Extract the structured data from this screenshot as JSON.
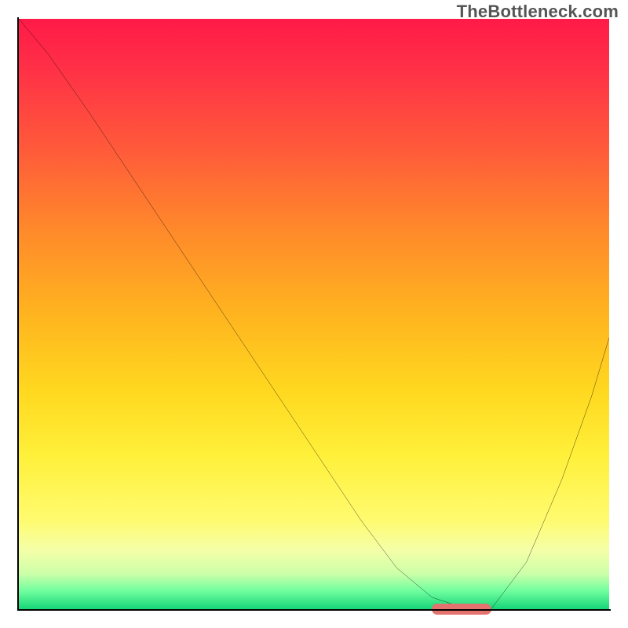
{
  "watermark": "TheBottleneck.com",
  "colors": {
    "gradient_top": "#ff1a47",
    "gradient_mid": "#ffd81f",
    "gradient_bottom": "#16d577",
    "curve": "#000000",
    "frame": "#000000",
    "optimum_marker": "#e4726e"
  },
  "chart_data": {
    "type": "line",
    "title": "",
    "xlabel": "",
    "ylabel": "",
    "xlim": [
      0,
      100
    ],
    "ylim": [
      0,
      100
    ],
    "grid": false,
    "legend": false,
    "annotations": [
      {
        "text": "TheBottleneck.com",
        "position": "top-right"
      }
    ],
    "series": [
      {
        "name": "bottleneck-curve",
        "x": [
          0,
          5,
          12,
          20,
          24,
          30,
          40,
          50,
          58,
          64,
          70,
          76,
          80,
          86,
          92,
          97,
          100
        ],
        "y": [
          100,
          94,
          84,
          72,
          66,
          57,
          42,
          27,
          15,
          7,
          2,
          0,
          0,
          8,
          22,
          36,
          46
        ]
      }
    ],
    "optimum_region": {
      "x_start": 70,
      "x_end": 80,
      "y": 0
    },
    "background": "vertical-gradient red→yellow→green (green = best)"
  }
}
